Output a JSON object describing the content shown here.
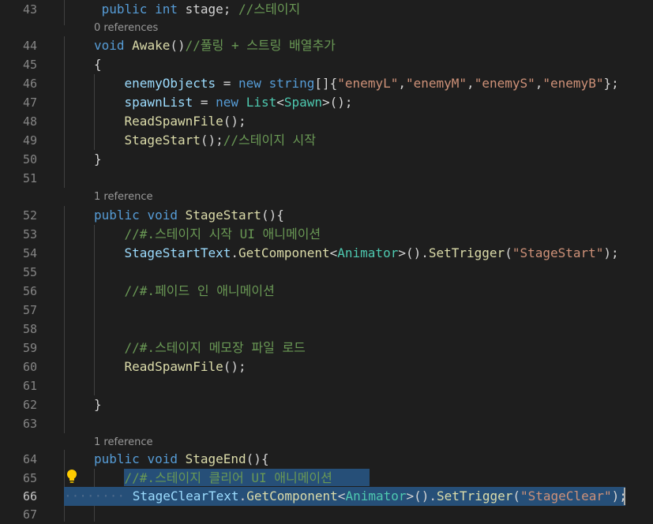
{
  "editor": {
    "lines": [
      {
        "type": "code",
        "num": "43",
        "indent": "",
        "tokens": [
          {
            "c": "k",
            "text": " public"
          },
          {
            "c": "p",
            "text": " "
          },
          {
            "c": "k",
            "text": "int"
          },
          {
            "c": "p",
            "text": " stage; "
          },
          {
            "c": "c",
            "text": "//스테이지"
          }
        ]
      },
      {
        "type": "lens",
        "text": "0 references"
      },
      {
        "type": "code",
        "num": "44",
        "indent": "",
        "tokens": [
          {
            "c": "k",
            "text": "void"
          },
          {
            "c": "p",
            "text": " "
          },
          {
            "c": "f",
            "text": "Awake"
          },
          {
            "c": "p",
            "text": "()"
          },
          {
            "c": "c",
            "text": "//풀링 + 스트링 배열추가"
          }
        ]
      },
      {
        "type": "code",
        "num": "45",
        "indent": "",
        "tokens": [
          {
            "c": "p",
            "text": "{"
          }
        ]
      },
      {
        "type": "code",
        "num": "46",
        "indent": "    ",
        "tokens": [
          {
            "c": "v",
            "text": "enemyObjects"
          },
          {
            "c": "p",
            "text": " = "
          },
          {
            "c": "k",
            "text": "new"
          },
          {
            "c": "p",
            "text": " "
          },
          {
            "c": "k",
            "text": "string"
          },
          {
            "c": "p",
            "text": "[]{"
          },
          {
            "c": "s",
            "text": "\"enemyL\""
          },
          {
            "c": "p",
            "text": ","
          },
          {
            "c": "s",
            "text": "\"enemyM\""
          },
          {
            "c": "p",
            "text": ","
          },
          {
            "c": "s",
            "text": "\"enemyS\""
          },
          {
            "c": "p",
            "text": ","
          },
          {
            "c": "s",
            "text": "\"enemyB\""
          },
          {
            "c": "p",
            "text": "};"
          }
        ]
      },
      {
        "type": "code",
        "num": "47",
        "indent": "    ",
        "tokens": [
          {
            "c": "v",
            "text": "spawnList"
          },
          {
            "c": "p",
            "text": " = "
          },
          {
            "c": "k",
            "text": "new"
          },
          {
            "c": "p",
            "text": " "
          },
          {
            "c": "t",
            "text": "List"
          },
          {
            "c": "p",
            "text": "<"
          },
          {
            "c": "t",
            "text": "Spawn"
          },
          {
            "c": "p",
            "text": ">();"
          }
        ]
      },
      {
        "type": "code",
        "num": "48",
        "indent": "    ",
        "tokens": [
          {
            "c": "f",
            "text": "ReadSpawnFile"
          },
          {
            "c": "p",
            "text": "();"
          }
        ]
      },
      {
        "type": "code",
        "num": "49",
        "indent": "    ",
        "tokens": [
          {
            "c": "f",
            "text": "StageStart"
          },
          {
            "c": "p",
            "text": "();"
          },
          {
            "c": "c",
            "text": "//스테이지 시작"
          }
        ]
      },
      {
        "type": "code",
        "num": "50",
        "indent": "",
        "tokens": [
          {
            "c": "p",
            "text": "}"
          }
        ]
      },
      {
        "type": "code",
        "num": "51",
        "indent": "",
        "tokens": []
      },
      {
        "type": "lens",
        "text": "1 reference"
      },
      {
        "type": "code",
        "num": "52",
        "indent": "",
        "tokens": [
          {
            "c": "k",
            "text": "public"
          },
          {
            "c": "p",
            "text": " "
          },
          {
            "c": "k",
            "text": "void"
          },
          {
            "c": "p",
            "text": " "
          },
          {
            "c": "f",
            "text": "StageStart"
          },
          {
            "c": "p",
            "text": "(){"
          }
        ]
      },
      {
        "type": "code",
        "num": "53",
        "indent": "    ",
        "tokens": [
          {
            "c": "c",
            "text": "//#.스테이지 시작 UI 애니메이션"
          }
        ]
      },
      {
        "type": "code",
        "num": "54",
        "indent": "    ",
        "tokens": [
          {
            "c": "v",
            "text": "StageStartText"
          },
          {
            "c": "p",
            "text": "."
          },
          {
            "c": "f",
            "text": "GetComponent"
          },
          {
            "c": "p",
            "text": "<"
          },
          {
            "c": "t",
            "text": "Animator"
          },
          {
            "c": "p",
            "text": ">()."
          },
          {
            "c": "f",
            "text": "SetTrigger"
          },
          {
            "c": "p",
            "text": "("
          },
          {
            "c": "s",
            "text": "\"StageStart\""
          },
          {
            "c": "p",
            "text": ");"
          }
        ]
      },
      {
        "type": "code",
        "num": "55",
        "indent": "",
        "tokens": []
      },
      {
        "type": "code",
        "num": "56",
        "indent": "    ",
        "tokens": [
          {
            "c": "c",
            "text": "//#.페이드 인 애니메이션"
          }
        ]
      },
      {
        "type": "code",
        "num": "57",
        "indent": "",
        "tokens": []
      },
      {
        "type": "code",
        "num": "58",
        "indent": "",
        "tokens": []
      },
      {
        "type": "code",
        "num": "59",
        "indent": "    ",
        "tokens": [
          {
            "c": "c",
            "text": "//#.스테이지 메모장 파일 로드"
          }
        ]
      },
      {
        "type": "code",
        "num": "60",
        "indent": "    ",
        "tokens": [
          {
            "c": "f",
            "text": "ReadSpawnFile"
          },
          {
            "c": "p",
            "text": "();"
          }
        ]
      },
      {
        "type": "code",
        "num": "61",
        "indent": "",
        "tokens": []
      },
      {
        "type": "code",
        "num": "62",
        "indent": "",
        "tokens": [
          {
            "c": "p",
            "text": "}"
          }
        ]
      },
      {
        "type": "code",
        "num": "63",
        "indent": "",
        "tokens": []
      },
      {
        "type": "lens",
        "text": "1 reference"
      },
      {
        "type": "code",
        "num": "64",
        "indent": "",
        "tokens": [
          {
            "c": "k",
            "text": "public"
          },
          {
            "c": "p",
            "text": " "
          },
          {
            "c": "k",
            "text": "void"
          },
          {
            "c": "p",
            "text": " "
          },
          {
            "c": "f",
            "text": "StageEnd"
          },
          {
            "c": "p",
            "text": "(){"
          }
        ]
      },
      {
        "type": "code",
        "num": "65",
        "indent": "    ",
        "tokens": [
          {
            "c": "c",
            "text": "//#.스테이지 클리어 UI 애니메이션"
          }
        ]
      },
      {
        "type": "code",
        "num": "66",
        "indent": "     ",
        "active": true,
        "tokens": [
          {
            "c": "v",
            "text": "StageClearText"
          },
          {
            "c": "p",
            "text": "."
          },
          {
            "c": "f",
            "text": "GetComponent"
          },
          {
            "c": "p",
            "text": "<"
          },
          {
            "c": "t",
            "text": "Animator"
          },
          {
            "c": "p",
            "text": ">()."
          },
          {
            "c": "f",
            "text": "SetTrigger"
          },
          {
            "c": "p",
            "text": "("
          },
          {
            "c": "s",
            "text": "\"StageClear\""
          },
          {
            "c": "p",
            "text": ");"
          }
        ]
      },
      {
        "type": "code",
        "num": "67",
        "indent": "",
        "tokens": []
      }
    ],
    "selection": {
      "start_line": "65",
      "end_line": "66"
    },
    "lightbulb": {
      "icon": "lightbulb-icon",
      "color": "#ffcc00"
    },
    "colors": {
      "background": "#1e1e1e",
      "selection": "#264f78",
      "keyword": "#569cd6",
      "type": "#4ec9b0",
      "function": "#dcdcaa",
      "variable": "#9cdcfe",
      "string": "#ce9178",
      "comment": "#6a9955"
    }
  }
}
